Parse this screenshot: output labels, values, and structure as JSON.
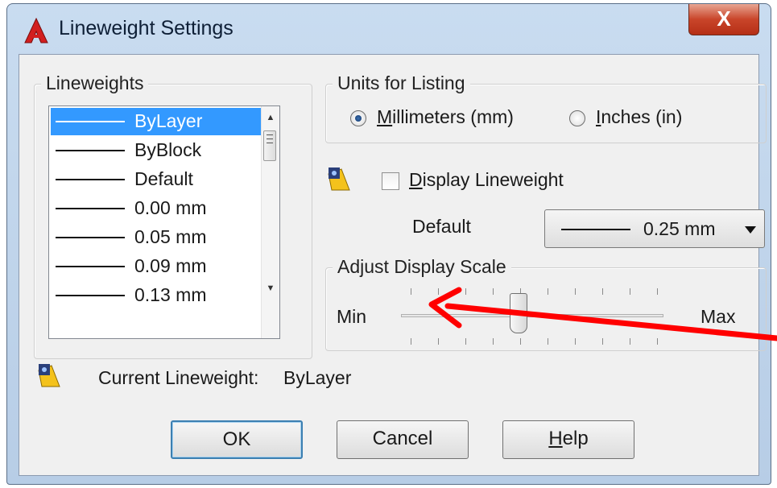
{
  "window": {
    "title": "Lineweight Settings",
    "close_glyph": "X"
  },
  "lineweights": {
    "legend": "Lineweights",
    "items": [
      "ByLayer",
      "ByBlock",
      "Default",
      "0.00 mm",
      "0.05 mm",
      "0.09 mm",
      "0.13 mm"
    ],
    "selected": "ByLayer"
  },
  "units": {
    "legend": "Units for Listing",
    "options": [
      {
        "label": "Millimeters (mm)",
        "accel": "M",
        "rest": "illimeters (mm)",
        "checked": true
      },
      {
        "label": "Inches (in)",
        "accel": "I",
        "rest": "nches (in)",
        "checked": false
      }
    ]
  },
  "display_lineweight": {
    "accel": "D",
    "rest": "isplay Lineweight",
    "label": "Display Lineweight",
    "checked": false
  },
  "default": {
    "label": "Default",
    "value": "0.25 mm"
  },
  "scale": {
    "legend": "Adjust Display Scale",
    "min_label": "Min",
    "max_label": "Max",
    "thumb_position_fraction": 0.45
  },
  "current": {
    "label": "Current Lineweight:",
    "value": "ByLayer"
  },
  "buttons": {
    "ok": "OK",
    "cancel": "Cancel",
    "help_accel": "H",
    "help_rest": "elp",
    "help": "Help"
  },
  "icons": {
    "app": "autocad-logo-icon",
    "close": "close-icon",
    "lineweight_info": "lineweight-info-icon"
  },
  "colors": {
    "selection": "#3399ff",
    "annotation_arrow": "#ff0000",
    "close_button": "#c9452a"
  }
}
